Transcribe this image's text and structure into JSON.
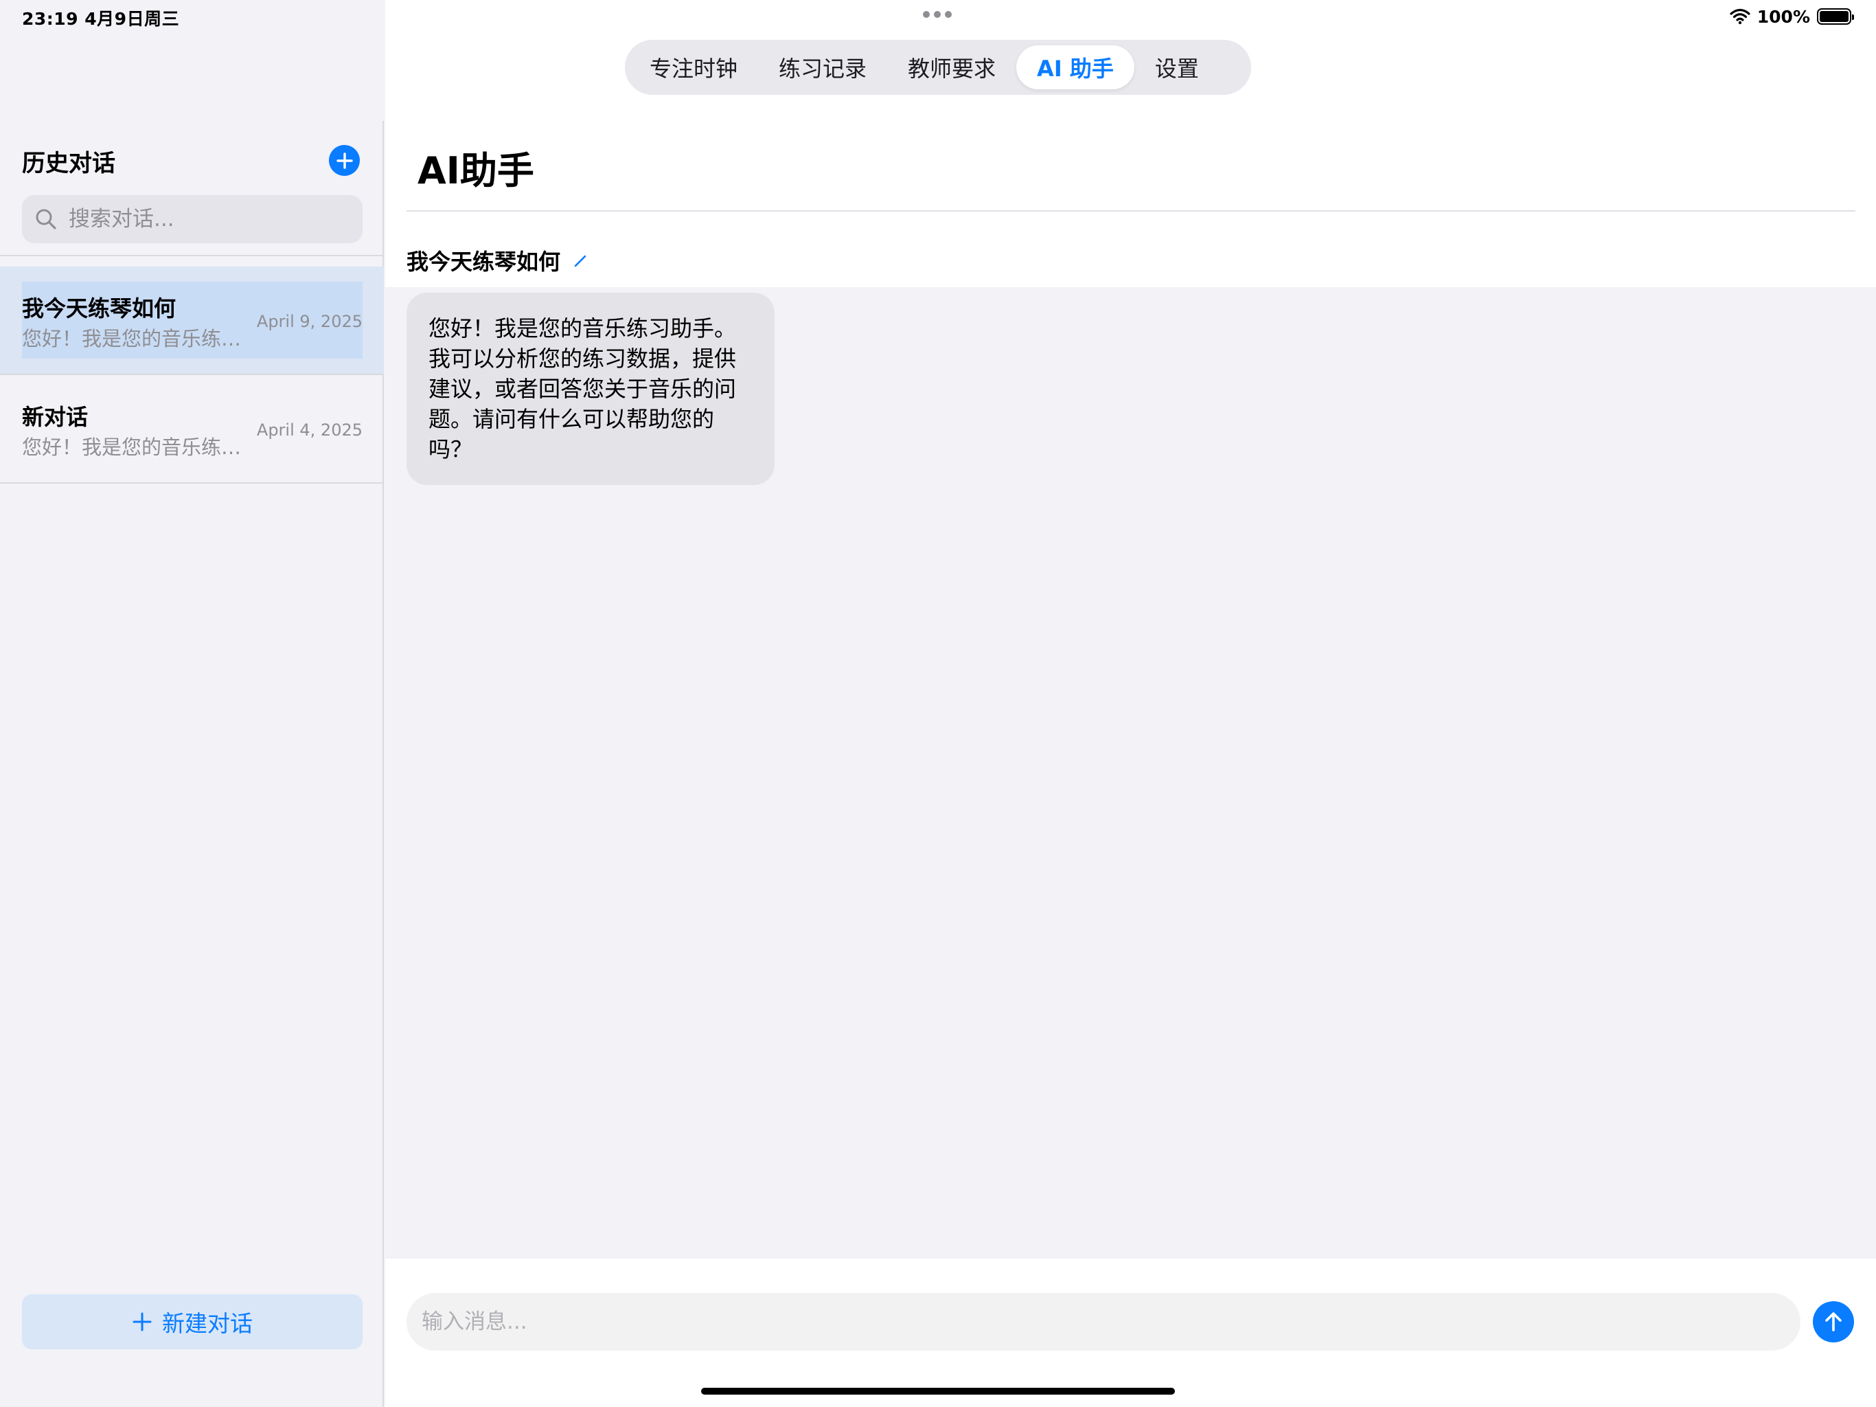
{
  "status_bar": {
    "time_date": "23:19   4月9日周三",
    "battery_percent": "100%",
    "battery_level": 1.0
  },
  "sidebar": {
    "title": "历史对话",
    "search_placeholder": "搜索对话...",
    "conversations": [
      {
        "title": "我今天练琴如何",
        "preview": "您好！我是您的音乐练习助手。",
        "date": "April 9, 2025",
        "selected": true
      },
      {
        "title": "新对话",
        "preview": "您好！我是您的音乐练习助手。",
        "date": "April 4, 2025",
        "selected": false
      }
    ],
    "new_button_label": "新建对话"
  },
  "tabs": [
    {
      "label": "专注时钟",
      "active": false
    },
    {
      "label": "练习记录",
      "active": false
    },
    {
      "label": "教师要求",
      "active": false
    },
    {
      "label": "AI 助手",
      "active": true
    },
    {
      "label": "设置",
      "active": false
    }
  ],
  "main": {
    "page_title": "AI助手",
    "conversation_title": "我今天练琴如何",
    "messages": [
      {
        "role": "assistant",
        "text": "您好！我是您的音乐练习助手。我可以分析您的练习数据，提供建议，或者回答您关于音乐的问题。请问有什么可以帮助您的吗？"
      }
    ],
    "input_placeholder": "输入消息..."
  },
  "icons": {
    "wifi": "wifi-icon",
    "battery": "battery-icon",
    "add": "plus-circle-icon",
    "search": "search-icon",
    "edit": "pencil-icon",
    "send": "arrow-up-icon"
  },
  "colors": {
    "accent": "#0a7cff",
    "selected_row": "#c9dcf5",
    "bubble": "#e3e3e8"
  }
}
